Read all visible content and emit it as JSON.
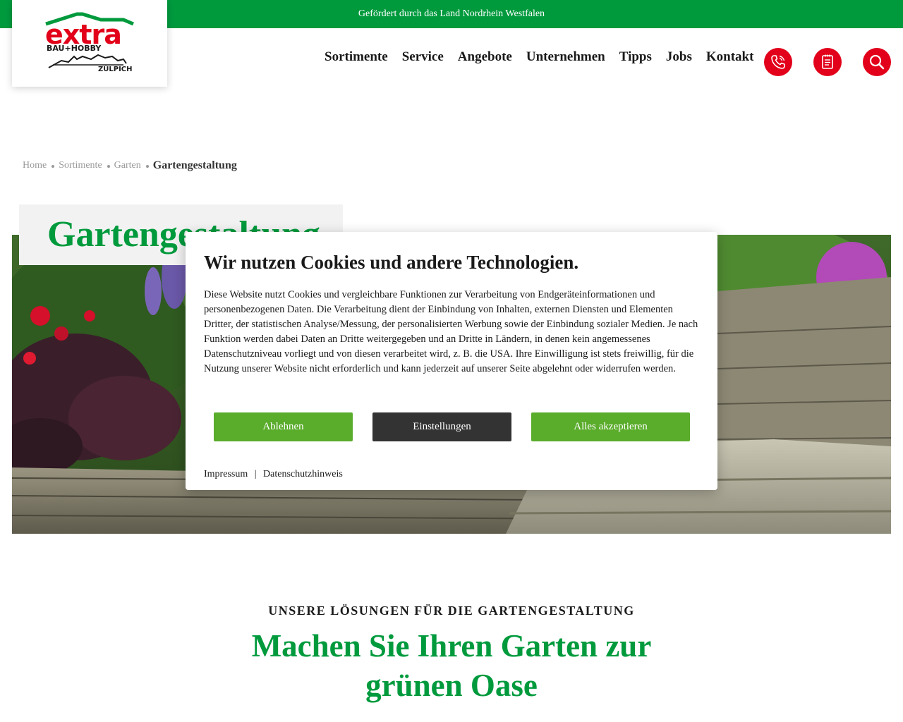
{
  "topbar": {
    "text": "Gefördert durch das Land Nordrhein Westfalen"
  },
  "logo": {
    "word": "extra",
    "line1": "BAU+HOBBY",
    "line2": "ZÜLPICH"
  },
  "nav": {
    "items": [
      "Sortimente",
      "Service",
      "Angebote",
      "Unternehmen",
      "Tipps",
      "Jobs",
      "Kontakt"
    ]
  },
  "actions": {
    "phone_icon": "phone-icon",
    "notepad_icon": "notepad-icon",
    "search_icon": "search-icon"
  },
  "breadcrumb": {
    "home": "Home",
    "sortimente": "Sortimente",
    "garten": "Garten",
    "current": "Gartengestaltung"
  },
  "hero": {
    "title": "Gartengestaltung"
  },
  "cookie_dialog": {
    "title": "Wir nutzen Cookies und andere Technologien.",
    "body": "Diese Website nutzt Cookies und vergleichbare Funktionen zur Verarbeitung von Endgeräteinformationen und personenbezogenen Daten. Die Verarbeitung dient der Einbindung von Inhalten, externen Diensten und Elementen Dritter, der statistischen Analyse/Messung, der personalisierten Werbung sowie der Einbindung sozialer Medien. Je nach Funktion werden dabei Daten an Dritte weitergegeben und an Dritte in Ländern, in denen kein angemessenes Datenschutzniveau vorliegt und von diesen verarbeitet wird, z. B. die USA. Ihre Einwilligung ist stets freiwillig, für die Nutzung unserer Website nicht erforderlich und kann jederzeit auf unserer Seite abgelehnt oder widerrufen werden.",
    "decline": "Ablehnen",
    "settings": "Einstellungen",
    "accept_all": "Alles akzeptieren",
    "impressum": "Impressum",
    "separator": "|",
    "privacy": "Datenschutzhinweis"
  },
  "section": {
    "eyebrow": "UNSERE LÖSUNGEN FÜR DIE GARTENGESTALTUNG",
    "title_line1": "Machen Sie Ihren Garten zur",
    "title_line2": "grünen Oase"
  },
  "colors": {
    "green": "#009a3d",
    "red": "#e2001a",
    "button_green": "#5aac2b",
    "button_dark": "#333333"
  }
}
